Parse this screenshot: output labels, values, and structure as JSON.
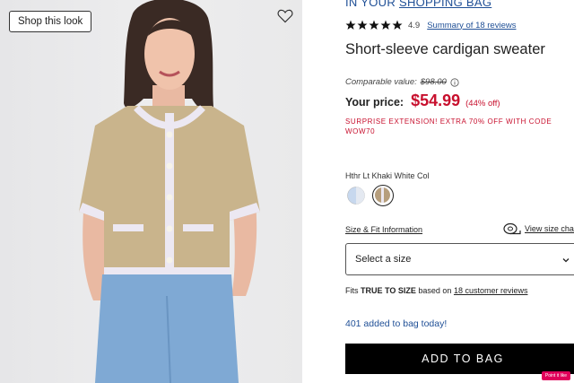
{
  "photo": {
    "shop_look_label": "Shop this look",
    "wishlist_icon": "heart-outline-icon"
  },
  "product": {
    "in_bag_prefix": "IN YOUR",
    "in_bag_link": "SHOPPING BAG",
    "rating": "4.9",
    "stars": 5,
    "reviews_link": "Summary of 18 reviews",
    "title": "Short-sleeve cardigan sweater",
    "comparable_label": "Comparable value:",
    "comparable_price": "$98.00",
    "price_label": "Your price:",
    "price": "$54.99",
    "discount": "(44% off)",
    "promo": "SURPRISE EXTENSION! EXTRA 70% OFF WITH CODE WOW70",
    "color_name": "Hthr Lt Khaki White Col",
    "size_fit_link": "Size & Fit Information",
    "size_chart_link": "View size chart",
    "size_select_value": "Select a size",
    "fits_prefix": "Fits",
    "fits_emphasis": "TRUE TO SIZE",
    "fits_middle": "based on",
    "fits_link": "18 customer reviews",
    "added_today": "401 added to bag today!",
    "add_to_bag": "ADD TO BAG",
    "pin_badge": "Point it like"
  },
  "colors": {
    "accent_blue": "#1f4f96",
    "sale_red": "#c8102e",
    "button": "#000000"
  }
}
